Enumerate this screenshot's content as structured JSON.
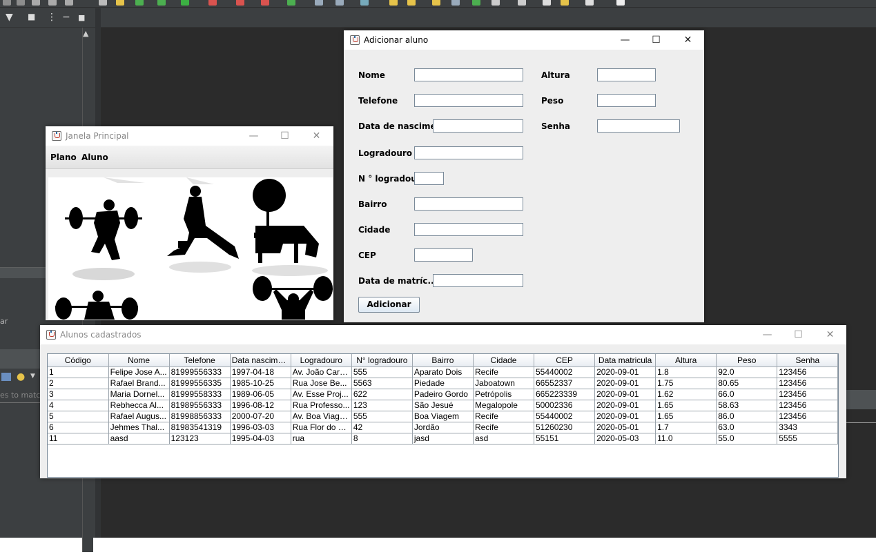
{
  "ide": {
    "search_placeholder": "es to matc",
    "left_text": "ar"
  },
  "add_dialog": {
    "title": "Adicionar aluno",
    "labels": {
      "nome": "Nome",
      "telefone": "Telefone",
      "nascimento": "Data de nascimento",
      "logradouro": "Logradouro",
      "numero": "N ° logradouro",
      "bairro": "Bairro",
      "cidade": "Cidade",
      "cep": "CEP",
      "matricula": "Data de matríc...",
      "altura": "Altura",
      "peso": "Peso",
      "senha": "Senha"
    },
    "values": {
      "nome": "",
      "telefone": "",
      "nascimento": "",
      "logradouro": "",
      "numero": "",
      "bairro": "",
      "cidade": "",
      "cep": "",
      "matricula": "",
      "altura": "",
      "peso": "",
      "senha": ""
    },
    "submit_label": "Adicionar"
  },
  "main_window": {
    "title": "Janela Principal",
    "menu": [
      "Plano",
      "Aluno"
    ]
  },
  "students_window": {
    "title": "Alunos cadastrados",
    "columns": [
      "Código",
      "Nome",
      "Telefone",
      "Data nascime...",
      "Logradouro",
      "N° logradouro",
      "Bairro",
      "Cidade",
      "CEP",
      "Data matricula",
      "Altura",
      "Peso",
      "Senha"
    ],
    "rows": [
      [
        "1",
        "Felipe Jose A...",
        "81999556333",
        "1997-04-18",
        "Av. João Card...",
        "555",
        "Aparato Dois",
        "Recife",
        "55440002",
        "2020-09-01",
        "1.8",
        "92.0",
        "123456"
      ],
      [
        "2",
        "Rafael Brand...",
        "81999556335",
        "1985-10-25",
        "Rua Jose Be...",
        "5563",
        "Piedade",
        "Jaboatown",
        "66552337",
        "2020-09-01",
        "1.75",
        "80.65",
        "123456"
      ],
      [
        "3",
        "Maria Dornel...",
        "81999558333",
        "1989-06-05",
        "Av. Esse Proj...",
        "622",
        "Padeiro Gordo",
        "Petrópolis",
        "665223339",
        "2020-09-01",
        "1.62",
        "66.0",
        "123456"
      ],
      [
        "4",
        "Rebhecca Al...",
        "81989556333",
        "1996-08-12",
        "Rua Professo...",
        "123",
        "São Jesué",
        "Megalopole",
        "50002336",
        "2020-09-01",
        "1.65",
        "58.63",
        "123456"
      ],
      [
        "5",
        "Rafael Augus...",
        "81998856333",
        "2000-07-20",
        "Av. Boa Viagem",
        "555",
        "Boa Viagem",
        "Recife",
        "55440002",
        "2020-09-01",
        "1.65",
        "86.0",
        "123456"
      ],
      [
        "6",
        "Jehmes Thal...",
        "81983541319",
        "1996-03-03",
        "Rua Flor do S...",
        "42",
        "Jordão",
        "Recife",
        "51260230",
        "2020-05-01",
        "1.7",
        "63.0",
        "3343"
      ],
      [
        "11",
        "aasd",
        "123123",
        "1995-04-03",
        "rua",
        "8",
        "jasd",
        "asd",
        "55151",
        "2020-05-03",
        "11.0",
        "55.0",
        "5555"
      ]
    ]
  },
  "icons": {
    "java": "java-cup-icon",
    "minimize": "minimize-icon",
    "maximize": "maximize-icon",
    "close": "close-icon"
  }
}
